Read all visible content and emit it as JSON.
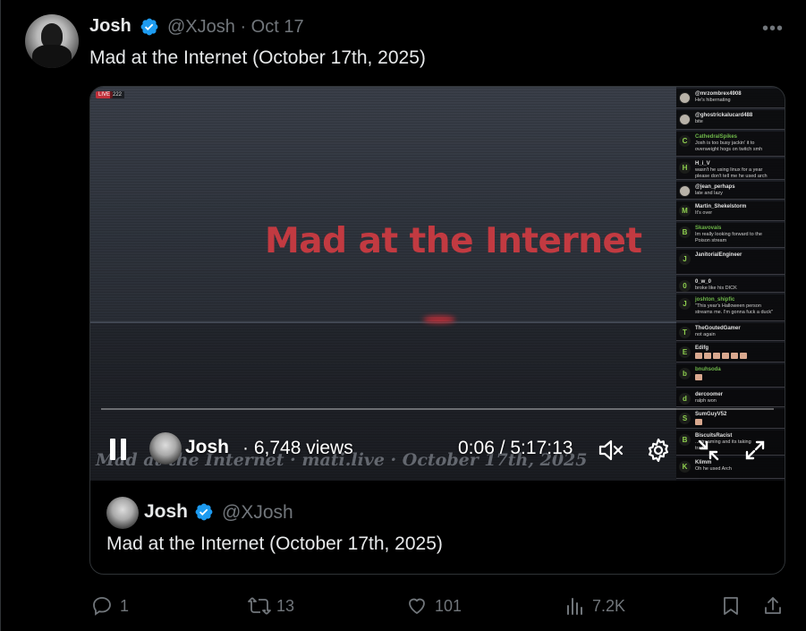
{
  "author": {
    "name": "Josh",
    "handle": "@XJosh",
    "sep_date": "· Oct 17"
  },
  "tweet": {
    "text": "Mad at the Internet (October 17th, 2025)"
  },
  "video": {
    "title": "Mad at the Internet",
    "live_label": "LIVE",
    "viewer_count": "222",
    "watermark": "Mad at the Internet · mati.live · October 17th, 2025",
    "controls": {
      "channel_name": "Josh",
      "views": "· 6,748 views",
      "time": "0:06 / 5:17:13",
      "progress": 0.0
    }
  },
  "chat": [
    {
      "initial": "",
      "user": "@mrzombrex4908",
      "text": "He's hibernating",
      "green": false,
      "avatar": true
    },
    {
      "initial": "",
      "user": "@ghostrickalucard488",
      "text": "bite",
      "green": false,
      "avatar": true
    },
    {
      "initial": "C",
      "user": "CathedralSpikes",
      "text": "Josh is too busy jackin' it to",
      "text2": "overweight hogs on twitch smh",
      "green": true
    },
    {
      "initial": "H",
      "user": "H_i_V",
      "text": "wasn't he using linux for a year",
      "text2": "please don't tell me he used arch",
      "green": false
    },
    {
      "initial": "",
      "user": "@jean_perhaps",
      "text": "late and lazy",
      "green": false,
      "avatar": true
    },
    {
      "initial": "M",
      "user": "Martin_Shekelstorm",
      "text": "It's over",
      "green": false
    },
    {
      "initial": "B",
      "user": "Skavovais",
      "text": "Im really looking forward to the",
      "text2": "Poison stream",
      "green": true
    },
    {
      "initial": "J",
      "user": "JanitorialEngineer",
      "text": "",
      "green": false
    },
    {
      "initial": "0",
      "user": "0_w_0",
      "text": "broke like his DICK",
      "green": false
    },
    {
      "initial": "J",
      "user": "joshton_shipfic",
      "text": "\"This year's Halloween person",
      "text2": "streams me. I'm gonna fuck a duck\"",
      "green": true
    },
    {
      "initial": "T",
      "user": "TheGoutedGamer",
      "text": "not again",
      "green": false
    },
    {
      "initial": "E",
      "user": "Edifg",
      "text": "",
      "green": false,
      "emotes": 6
    },
    {
      "initial": "b",
      "user": "bnuhsoda",
      "text": "",
      "green": true,
      "emotes": 1
    },
    {
      "initial": "d",
      "user": "dercoomer",
      "text": "ralph won",
      "green": false
    },
    {
      "initial": "S",
      "user": "SumGuyV52",
      "text": "",
      "green": false,
      "emotes": 1
    },
    {
      "initial": "B",
      "user": "BiscuitsRacist",
      "text": "...streaming and its taking",
      "text2": "tradic",
      "green": false
    },
    {
      "initial": "K",
      "user": "Klimm",
      "text": "Oh he used Arch",
      "green": false
    }
  ],
  "quote": {
    "name": "Josh",
    "handle": "@XJosh",
    "text": "Mad at the Internet (October 17th, 2025)"
  },
  "actions": {
    "replies": "1",
    "reposts": "13",
    "likes": "101",
    "views": "7.2K"
  },
  "colors": {
    "verified": "#1d9bf0",
    "accent_red": "#c23a41",
    "muted": "#71767b"
  }
}
